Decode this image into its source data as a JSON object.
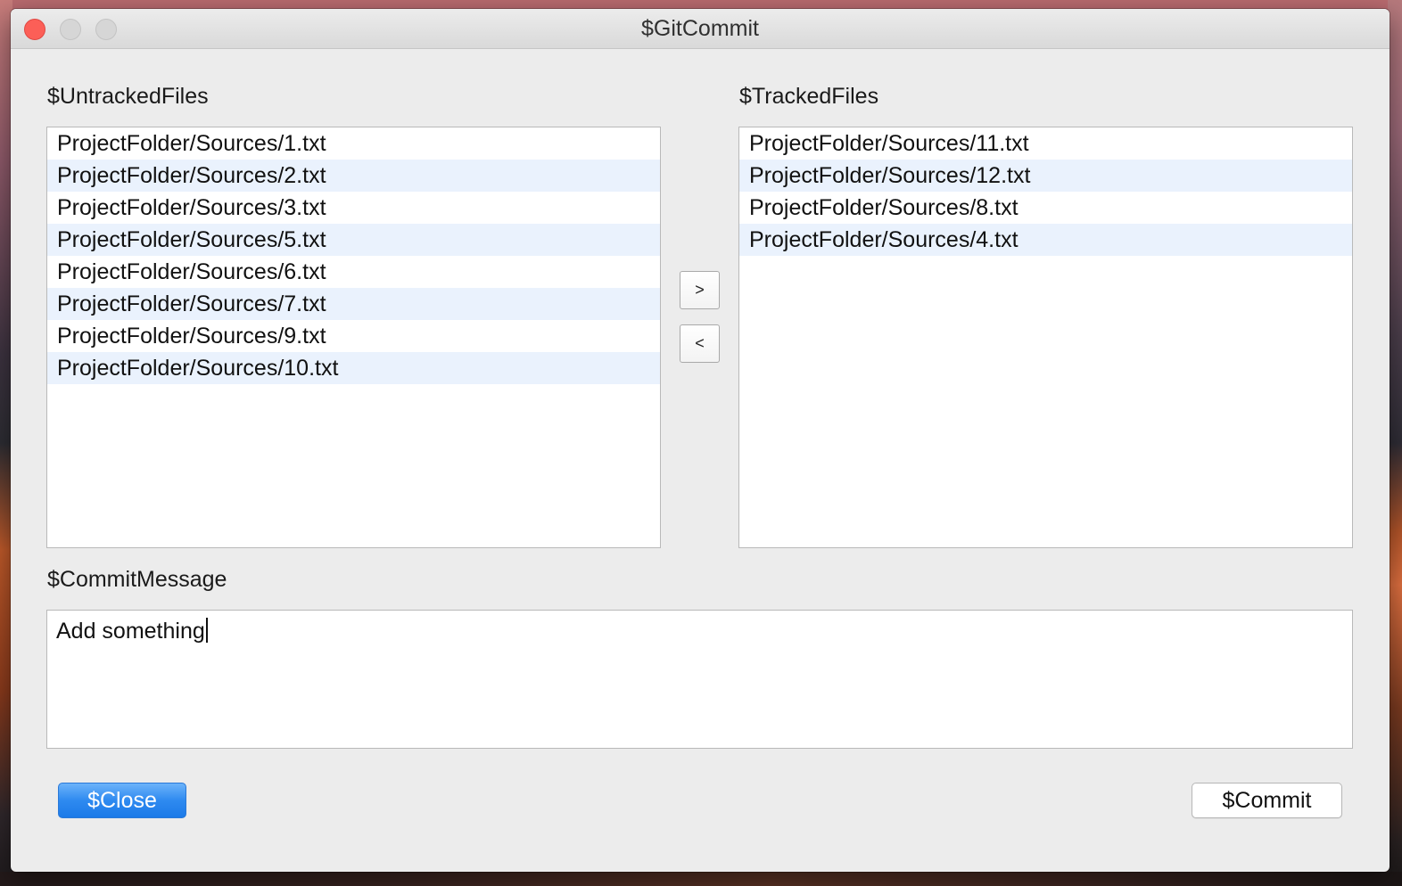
{
  "window": {
    "title": "$GitCommit"
  },
  "untracked": {
    "label": "$UntrackedFiles",
    "files": [
      "ProjectFolder/Sources/1.txt",
      "ProjectFolder/Sources/2.txt",
      "ProjectFolder/Sources/3.txt",
      "ProjectFolder/Sources/5.txt",
      "ProjectFolder/Sources/6.txt",
      "ProjectFolder/Sources/7.txt",
      "ProjectFolder/Sources/9.txt",
      "ProjectFolder/Sources/10.txt"
    ]
  },
  "tracked": {
    "label": "$TrackedFiles",
    "files": [
      "ProjectFolder/Sources/11.txt",
      "ProjectFolder/Sources/12.txt",
      "ProjectFolder/Sources/8.txt",
      "ProjectFolder/Sources/4.txt"
    ]
  },
  "transfer": {
    "move_right_label": ">",
    "move_left_label": "<"
  },
  "commit_message": {
    "label": "$CommitMessage",
    "value": "Add something"
  },
  "buttons": {
    "close_label": "$Close",
    "commit_label": "$Commit"
  },
  "colors": {
    "accent": "#2e8af0",
    "row_alt": "#eaf2fd",
    "window_bg": "#ececec",
    "close_light": "#fc5f57"
  }
}
